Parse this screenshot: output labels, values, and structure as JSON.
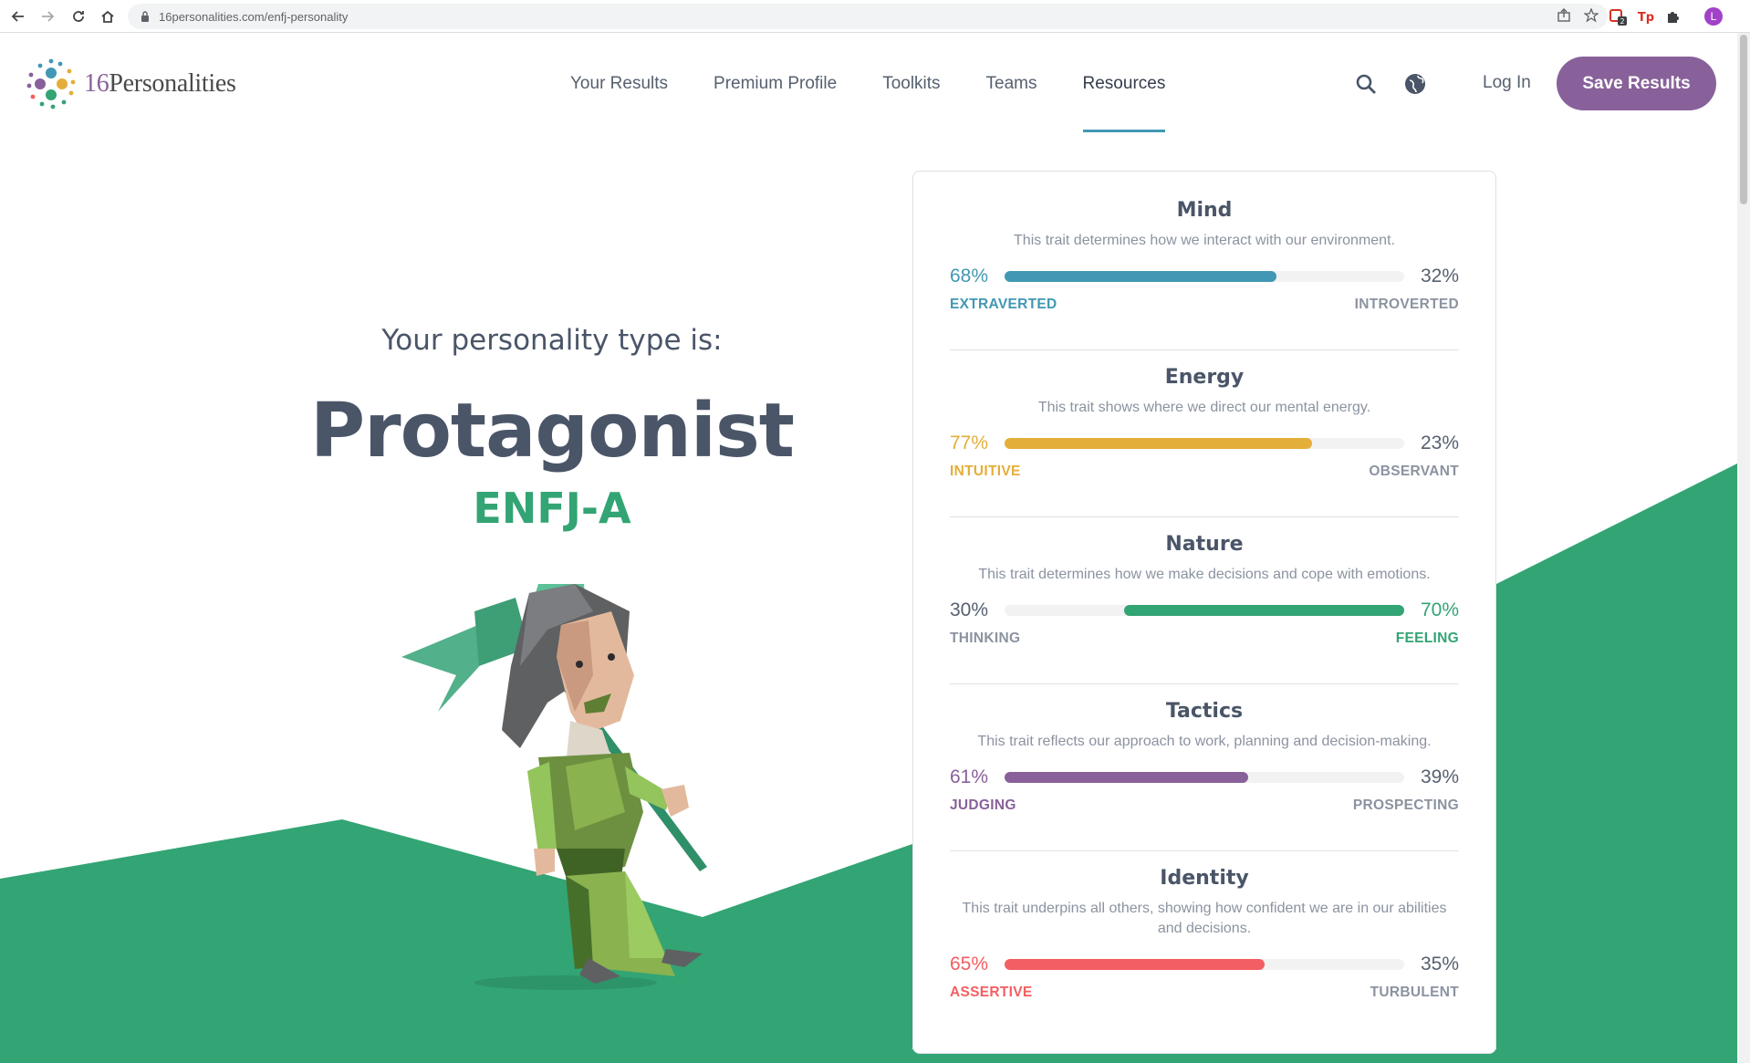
{
  "browser": {
    "url": "16personalities.com/enfj-personality",
    "profile_initial": "L",
    "ext_badge": "2"
  },
  "header": {
    "logo_num": "16",
    "logo_word": "Personalities",
    "nav": [
      "Your Results",
      "Premium Profile",
      "Toolkits",
      "Teams",
      "Resources"
    ],
    "login": "Log In",
    "save": "Save Results"
  },
  "hero": {
    "pre": "Your personality type is:",
    "title": "Protagonist",
    "code": "ENFJ-A"
  },
  "colors": {
    "mind": "#4298b4",
    "energy": "#e4ae3a",
    "nature": "#33a474",
    "tactics": "#88619a",
    "identity": "#f25e62",
    "green_bg": "#33a474",
    "brand_purple": "#88619a"
  },
  "traits": [
    {
      "name": "Mind",
      "desc": "This trait determines how we interact with our environment.",
      "left_pct": "68%",
      "right_pct": "32%",
      "left_label": "EXTRAVERTED",
      "right_label": "INTROVERTED",
      "value": 0.68,
      "dominant": "left"
    },
    {
      "name": "Energy",
      "desc": "This trait shows where we direct our mental energy.",
      "left_pct": "77%",
      "right_pct": "23%",
      "left_label": "INTUITIVE",
      "right_label": "OBSERVANT",
      "value": 0.77,
      "dominant": "left"
    },
    {
      "name": "Nature",
      "desc": "This trait determines how we make decisions and cope with emotions.",
      "left_pct": "30%",
      "right_pct": "70%",
      "left_label": "THINKING",
      "right_label": "FEELING",
      "value": 0.7,
      "dominant": "right"
    },
    {
      "name": "Tactics",
      "desc": "This trait reflects our approach to work, planning and decision-making.",
      "left_pct": "61%",
      "right_pct": "39%",
      "left_label": "JUDGING",
      "right_label": "PROSPECTING",
      "value": 0.61,
      "dominant": "left"
    },
    {
      "name": "Identity",
      "desc": "This trait underpins all others, showing how confident we are in our abilities and decisions.",
      "left_pct": "65%",
      "right_pct": "35%",
      "left_label": "ASSERTIVE",
      "right_label": "TURBULENT",
      "value": 0.65,
      "dominant": "left"
    }
  ]
}
